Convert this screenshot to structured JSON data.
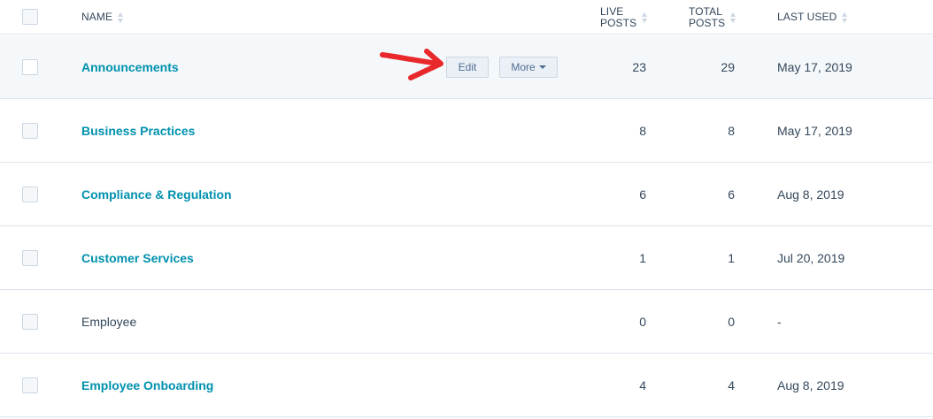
{
  "header": {
    "name": "NAME",
    "live_posts_line1": "LIVE",
    "live_posts_line2": "POSTS",
    "total_posts_line1": "TOTAL",
    "total_posts_line2": "POSTS",
    "last_used": "LAST USED"
  },
  "row_actions": {
    "edit_label": "Edit",
    "more_label": "More"
  },
  "rows": [
    {
      "name": "Announcements",
      "live_posts": "23",
      "total_posts": "29",
      "last_used": "May 17, 2019",
      "link": true
    },
    {
      "name": "Business Practices",
      "live_posts": "8",
      "total_posts": "8",
      "last_used": "May 17, 2019",
      "link": true
    },
    {
      "name": "Compliance & Regulation",
      "live_posts": "6",
      "total_posts": "6",
      "last_used": "Aug 8, 2019",
      "link": true
    },
    {
      "name": "Customer Services",
      "live_posts": "1",
      "total_posts": "1",
      "last_used": "Jul 20, 2019",
      "link": true
    },
    {
      "name": "Employee",
      "live_posts": "0",
      "total_posts": "0",
      "last_used": "-",
      "link": false
    },
    {
      "name": "Employee Onboarding",
      "live_posts": "4",
      "total_posts": "4",
      "last_used": "Aug 8, 2019",
      "link": true
    }
  ],
  "colors": {
    "link": "#0091ae",
    "text": "#33475b",
    "hover_row": "#f5f8fa",
    "border": "#dfe3eb",
    "annotation_arrow": "#e8282b"
  }
}
